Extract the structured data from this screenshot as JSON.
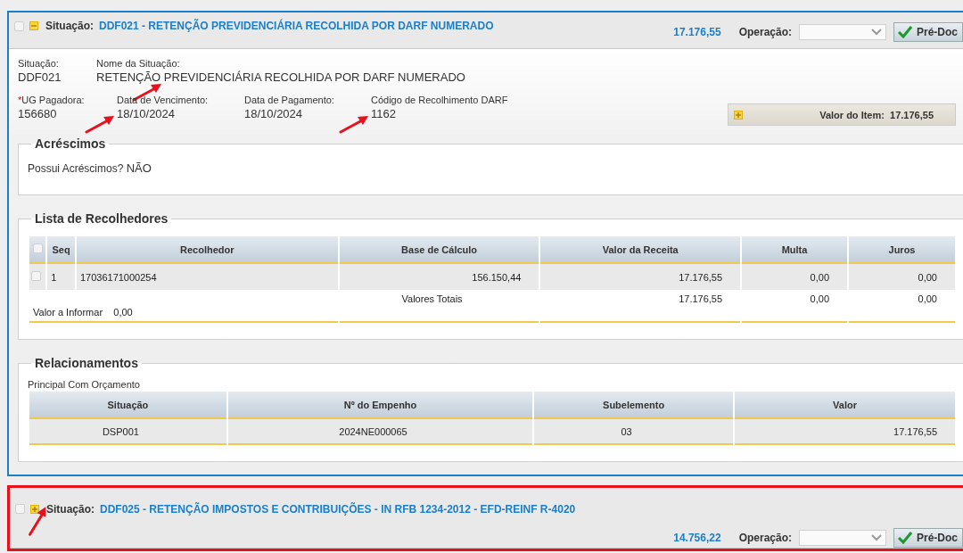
{
  "panels": [
    {
      "checked": false,
      "expanded": true,
      "highlighted": false,
      "arrow": false,
      "label": "Situação:",
      "title": "DDF021 - RETENÇÃO PREVIDENCIÁRIA RECOLHIDA POR DARF NUMERADO",
      "amount": "17.176,55",
      "operation_label": "Operação:",
      "button": "Pré-Doc",
      "details": {
        "rows": [
          [
            {
              "label": "Situação:",
              "value": "DDF021",
              "arrow": false
            },
            {
              "label": "Nome da Situação:",
              "value": "RETENÇÃO PREVIDENCIÁRIA RECOLHIDA POR DARF NUMERADO",
              "arrow": true
            }
          ],
          [
            {
              "marker": "*",
              "label": "UG Pagadora:",
              "value": "156680",
              "arrow": false
            },
            {
              "label": "Data de Vencimento:",
              "value": "18/10/2024",
              "arrow": true
            },
            {
              "label": "Data de Pagamento:",
              "value": "18/10/2024",
              "arrow": false
            },
            {
              "label": "Código de Recolhimento DARF",
              "value": "1162",
              "arrow": true
            }
          ]
        ],
        "item_value": {
          "expanded": false,
          "label": "Valor do Item:",
          "value": "17.176,55"
        },
        "acrescimos": {
          "legend": "Acréscimos",
          "question": "Possui Acréscimos?",
          "answer": "NÃO"
        },
        "recolhedores": {
          "legend": "Lista de Recolhedores",
          "all_checked": false,
          "columns": [
            "Seq",
            "Recolhedor",
            "Base de Cálculo",
            "Valor da Receita",
            "Multa",
            "Juros"
          ],
          "rows": [
            {
              "checked": false,
              "cells": [
                "1",
                "17036171000254",
                "156.150,44",
                "17.176,55",
                "0,00",
                "0,00"
              ]
            }
          ],
          "totals_label": "Valores Totais",
          "totals": [
            "17.176,55",
            "0,00",
            "0,00"
          ],
          "informar_label": "Valor a Informar",
          "informar_value": "0,00"
        },
        "relacionamentos": {
          "legend": "Relacionamentos",
          "subtitle": "Principal Com Orçamento",
          "columns": [
            "Situação",
            "Nº do Empenho",
            "Subelemento",
            "Valor"
          ],
          "rows": [
            [
              "DSP001",
              "2024NE000065",
              "03",
              "17.176,55"
            ]
          ]
        }
      }
    },
    {
      "checked": false,
      "expanded": false,
      "highlighted": true,
      "arrow": true,
      "label": "Situação:",
      "title": "DDF025 - RETENÇÃO IMPOSTOS E CONTRIBUIÇÕES - IN RFB 1234-2012 - EFD-REINF R-4020",
      "amount": "14.756,22",
      "operation_label": "Operação:",
      "button": "Pré-Doc"
    }
  ]
}
